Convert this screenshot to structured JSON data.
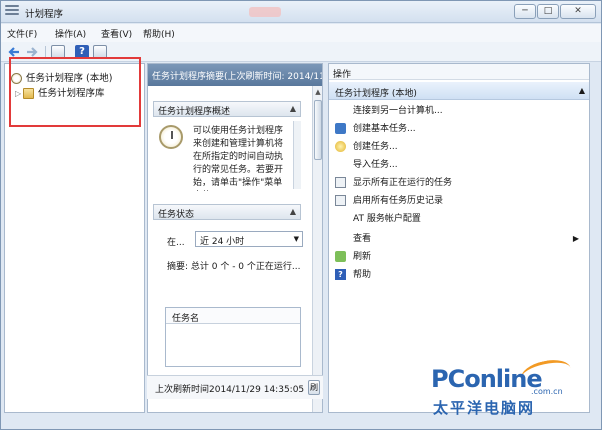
{
  "window": {
    "title": "计划程序",
    "controls": {
      "minimize": "─",
      "maximize": "□",
      "close": "✕"
    }
  },
  "menu": [
    "文件(F)",
    "操作(A)",
    "查看(V)",
    "帮助(H)"
  ],
  "toolbar": {
    "help_glyph": "?"
  },
  "tree": {
    "root": "任务计划程序 (本地)",
    "child": "任务计划程序库",
    "expander": "▷"
  },
  "middle": {
    "header": "任务计划程序摘要(上次刷新时间: 2014/11/29",
    "overview": {
      "title": "任务计划程序概述",
      "text": "可以使用任务计划程序来创建和管理计算机将在所指定的时间自动执行的常见任务。若要开始，请单击\"操作\"菜单中的"
    },
    "status": {
      "title": "任务状态",
      "period_label": "在...",
      "period_value": "近 24 小时",
      "summary": "摘要: 总计 0 个 - 0 个正在运行..."
    },
    "table": {
      "column": "任务名"
    },
    "footer": "上次刷新时间2014/11/29 14:35:05",
    "refresh_label": "刷"
  },
  "actions": {
    "header": "操作",
    "group": "任务计划程序 (本地)",
    "items": [
      {
        "label": "连接到另一台计算机...",
        "icon": "none-icon"
      },
      {
        "label": "创建基本任务...",
        "icon": "basic-task-icon"
      },
      {
        "label": "创建任务...",
        "icon": "task-icon"
      },
      {
        "label": "导入任务...",
        "icon": "none-icon"
      },
      {
        "label": "显示所有正在运行的任务",
        "icon": "running-tasks-icon"
      },
      {
        "label": "启用所有任务历史记录",
        "icon": "history-icon"
      },
      {
        "label": "AT 服务帐户配置",
        "icon": "none-icon"
      },
      {
        "label": "查看",
        "icon": "none-icon"
      },
      {
        "label": "刷新",
        "icon": "refresh-icon"
      },
      {
        "label": "帮助",
        "icon": "help-icon"
      }
    ]
  },
  "watermark": {
    "brand": "PConline",
    "domain": ".com.cn",
    "tagline": "太平洋电脑网"
  }
}
